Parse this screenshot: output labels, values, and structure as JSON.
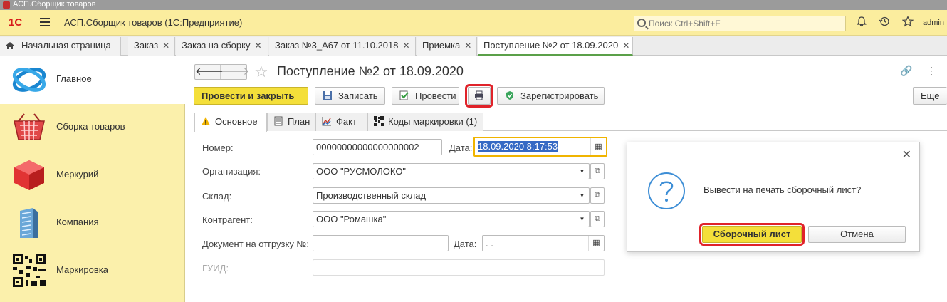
{
  "os_window": {
    "title": "АСП.Сборщик товаров"
  },
  "header": {
    "logo": "1С",
    "app_title": "АСП.Сборщик товаров  (1С:Предприятие)",
    "search_placeholder": "Поиск Ctrl+Shift+F",
    "user": "admin"
  },
  "open_tabs": [
    {
      "label": "Начальная страница",
      "closable": false
    },
    {
      "label": "Заказ",
      "closable": true
    },
    {
      "label": "Заказ на сборку",
      "closable": true
    },
    {
      "label": "Заказ №3_А67 от 11.10.2018",
      "closable": true
    },
    {
      "label": "Приемка",
      "closable": true
    },
    {
      "label": "Поступление №2 от 18.09.2020",
      "closable": true,
      "active": true
    }
  ],
  "sidebar": {
    "items": [
      {
        "label": "Главное",
        "icon": "main-section-icon",
        "selected": true
      },
      {
        "label": "Сборка товаров",
        "icon": "basket-icon"
      },
      {
        "label": "Меркурий",
        "icon": "cube-icon"
      },
      {
        "label": "Компания",
        "icon": "building-icon"
      },
      {
        "label": "Маркировка",
        "icon": "qr-code-icon"
      }
    ]
  },
  "form": {
    "title": "Поступление №2 от 18.09.2020",
    "toolbar": {
      "post_close": "Провести и закрыть",
      "save": "Записать",
      "post": "Провести",
      "register": "Зарегистрировать",
      "more": "Еще"
    },
    "tabs": [
      {
        "label": "Основное",
        "icon": "warning-icon",
        "active": true
      },
      {
        "label": "План",
        "icon": "plan-icon"
      },
      {
        "label": "Факт",
        "icon": "chart-icon"
      },
      {
        "label": "Коды маркировки  (1)",
        "icon": "qr-code-icon"
      }
    ],
    "fields": {
      "number_label": "Номер:",
      "number_value": "00000000000000000002",
      "date_label": "Дата:",
      "date_value": "18.09.2020  8:17:53",
      "org_label": "Организация:",
      "org_value": "ООО \"РУСМОЛОКО\"",
      "warehouse_label": "Склад:",
      "warehouse_value": "Производственный склад",
      "counterparty_label": "Контрагент:",
      "counterparty_value": "ООО \"Ромашка\"",
      "shipdoc_label": "Документ на отгрузку №:",
      "shipdoc_value": "",
      "shipdoc_date_label": "Дата:",
      "shipdoc_date_value": " .  .",
      "guid_label": "ГУИД:",
      "guid_value": ""
    }
  },
  "dialog": {
    "message": "Вывести на печать сборочный лист?",
    "confirm": "Сборочный лист",
    "cancel": "Отмена"
  },
  "colors": {
    "header_bg": "#fbed9e",
    "sidebar_bg": "#fbf0ab",
    "primary_button": "#f4df3a",
    "highlight": "#e0232a",
    "active_tab_underline": "#5ba049"
  }
}
